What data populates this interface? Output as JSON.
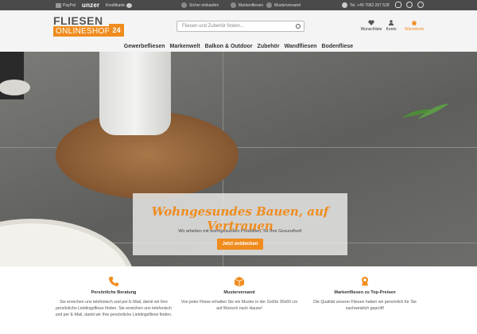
{
  "topbar": {
    "payments": [
      "PayPal",
      "unzer",
      "Kreditkarte"
    ],
    "trust": [
      "Sicher einkaufen",
      "Markenfliesen",
      "Musterversand"
    ],
    "phone": "Tel. +49 7062 267 528",
    "social_icons": [
      "instagram-icon",
      "facebook-icon",
      "pinterest-icon"
    ]
  },
  "header": {
    "logo_top": "FLIESEN",
    "logo_bottom": "ONLINESHOP",
    "logo_badge": "24",
    "search_placeholder": "Fliesen und Zubehör finden...",
    "account_items": [
      {
        "label": "Wunschliste",
        "icon": "heart-icon"
      },
      {
        "label": "Konto",
        "icon": "user-icon"
      },
      {
        "label": "Warenkorb",
        "icon": "cart-icon"
      }
    ],
    "nav": [
      "Gewerbefliesen",
      "Markenwelt",
      "Balkon & Outdoor",
      "Zubehör",
      "Wandfliesen",
      "Bodenfliese"
    ]
  },
  "hero": {
    "title": "Wohngesundes Bauen, auf Vertrauen",
    "subtitle": "Wir arbeiten mit wohngesunden Produkten, für Ihre Gesundheit!",
    "button": "Jetzt entdecken"
  },
  "features": [
    {
      "icon": "phone-icon",
      "title": "Persönliche Beratung",
      "text": "Sie erreichen uns telefonisch und per E-Mail, damit wir Ihre persönliche Lieblingsfliese finden. Sie erreichen uns telefonisch und per E-Mail, damit wir Ihre persönliche Lieblingsfliese finden."
    },
    {
      "icon": "box-icon",
      "title": "Musterversand",
      "text": "Von jeder Fliese erhalten Sie ein Muster in der Größe 30x60 cm auf Wunsch nach Hause!"
    },
    {
      "icon": "award-icon",
      "title": "Markenfliesen zu Top-Preisen",
      "text": "Die Qualität unserer Fliesen haben wir persönlich für Sie nachweislich geprüft!"
    }
  ],
  "colors": {
    "accent": "#f08c1e",
    "topbar": "#4a4a4a",
    "header": "#f4f4f4"
  }
}
